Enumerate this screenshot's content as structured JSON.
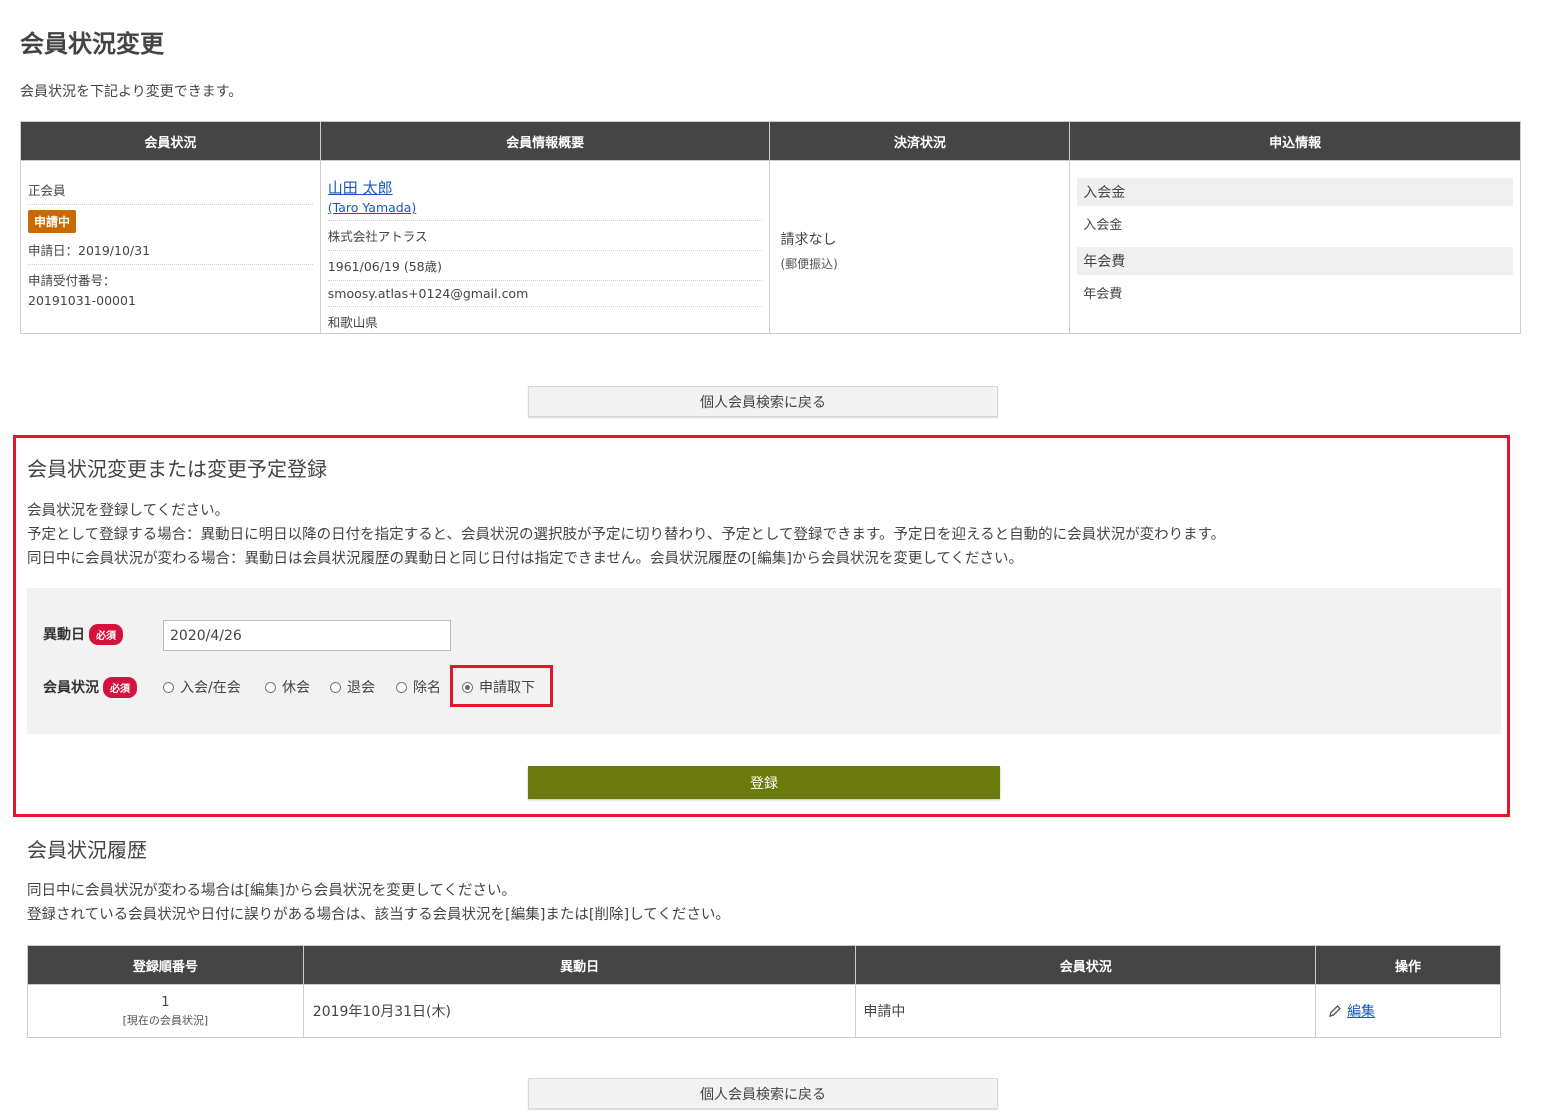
{
  "page": {
    "title": "会員状況変更",
    "description": "会員状況を下記より変更できます。"
  },
  "summary": {
    "headers": [
      "会員状況",
      "会員情報概要",
      "決済状況",
      "申込情報"
    ],
    "status": {
      "type": "正会員",
      "badge": "申請中",
      "apply_date": "申請日：2019/10/31",
      "receipt_label": "申請受付番号：",
      "receipt_number": "20191031-00001"
    },
    "member": {
      "name": "山田 太郎",
      "name_en": "(Taro Yamada)",
      "company": "株式会社アトラス",
      "birthday": "1961/06/19 (58歳)",
      "email": "smoosy.atlas+0124@gmail.com",
      "prefecture": "和歌山県"
    },
    "payment": {
      "status": "請求なし",
      "method": "(郵便振込)"
    },
    "application": [
      {
        "label": "入会金",
        "value": "入会金"
      },
      {
        "label": "年会費",
        "value": "年会費"
      }
    ]
  },
  "back_button": "個人会員検索に戻る",
  "change_section": {
    "title": "会員状況変更または変更予定登録",
    "lines": [
      "会員状況を登録してください。",
      "予定として登録する場合：異動日に明日以降の日付を指定すると、会員状況の選択肢が予定に切り替わり、予定として登録できます。予定日を迎えると自動的に会員状況が変わります。",
      "同日中に会員状況が変わる場合：異動日は会員状況履歴の異動日と同じ日付は指定できません。会員状況履歴の[編集]から会員状況を変更してください。"
    ],
    "date_label": "異動日",
    "required": "必須",
    "date_value": "2020/4/26",
    "status_label": "会員状況",
    "options": [
      "入会/在会",
      "休会",
      "退会",
      "除名",
      "申請取下"
    ],
    "selected_option": "申請取下",
    "submit": "登録"
  },
  "history_section": {
    "title": "会員状況履歴",
    "lines": [
      "同日中に会員状況が変わる場合は[編集]から会員状況を変更してください。",
      "登録されている会員状況や日付に誤りがある場合は、該当する会員状況を[編集]または[削除]してください。"
    ],
    "headers": [
      "登録順番号",
      "異動日",
      "会員状況",
      "操作"
    ],
    "rows": [
      {
        "no": "1",
        "note": "[現在の会員状況]",
        "date": "2019年10月31日(木)",
        "status": "申請中",
        "action": "編集"
      }
    ]
  }
}
